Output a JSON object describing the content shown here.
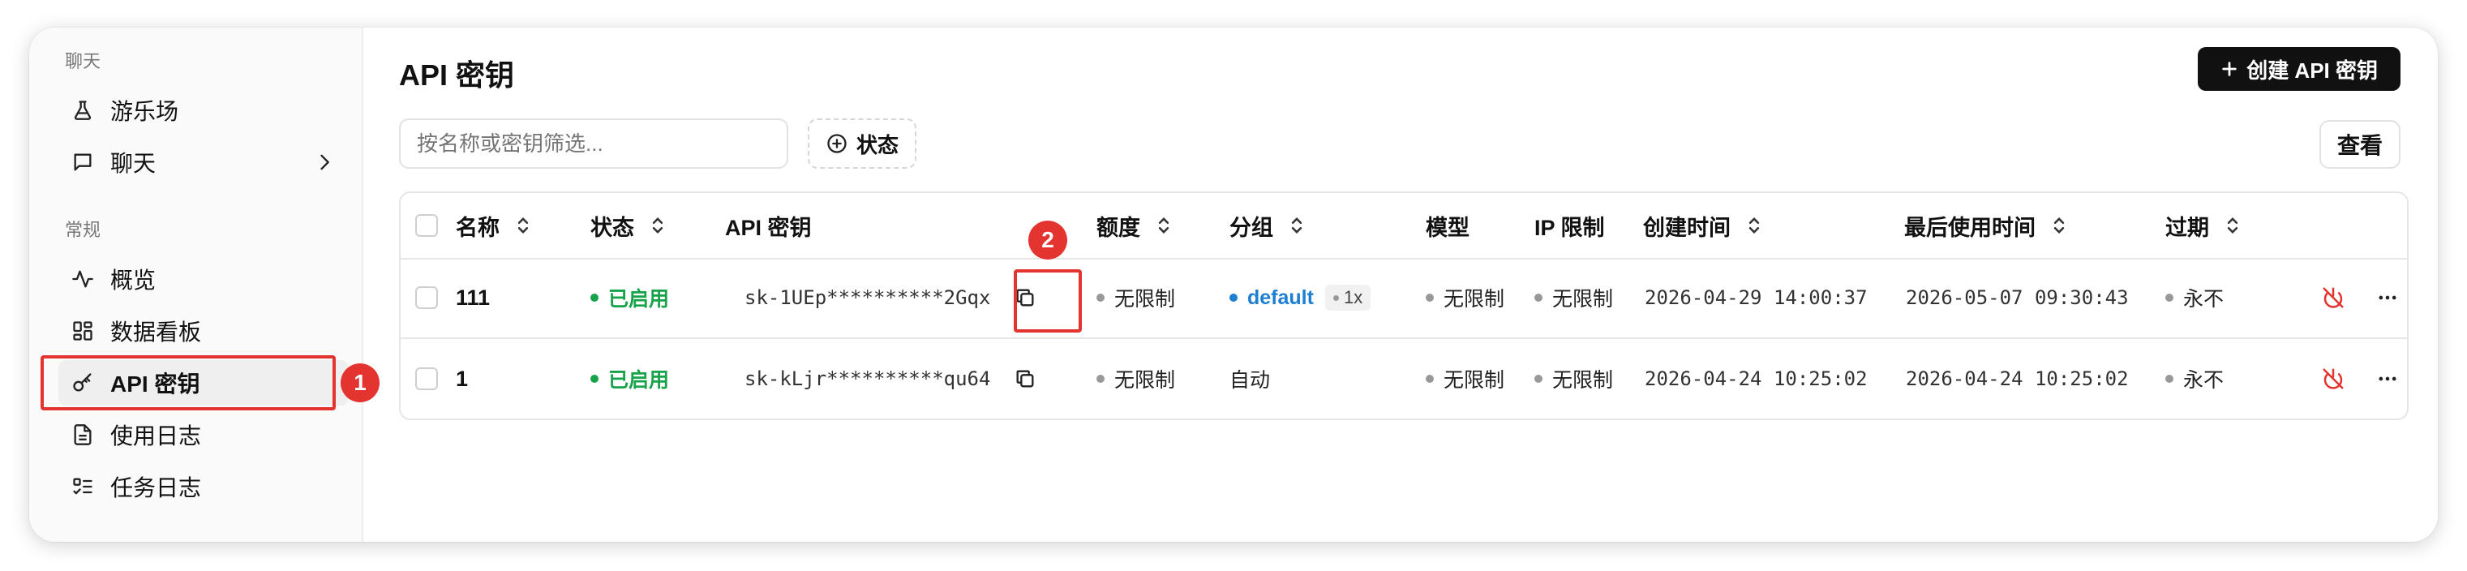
{
  "sidebar": {
    "chat_section_label": "聊天",
    "general_section_label": "常规",
    "items": [
      {
        "label": "游乐场"
      },
      {
        "label": "聊天"
      },
      {
        "label": "概览"
      },
      {
        "label": "数据看板"
      },
      {
        "label": "API 密钥"
      },
      {
        "label": "使用日志"
      },
      {
        "label": "任务日志"
      }
    ]
  },
  "annotations": {
    "badge1": "1",
    "badge2": "2"
  },
  "header": {
    "title": "API 密钥",
    "create_button": "创建 API 密钥"
  },
  "toolbar": {
    "search_placeholder": "按名称或密钥筛选...",
    "status_filter": "状态",
    "view_button": "查看"
  },
  "table": {
    "columns": [
      "名称",
      "状态",
      "API 密钥",
      "额度",
      "分组",
      "模型",
      "IP 限制",
      "创建时间",
      "最后使用时间",
      "过期"
    ],
    "rows": [
      {
        "name": "111",
        "status": "已启用",
        "key": "sk-1UEp**********2Gqx",
        "quota": "无限制",
        "group": "default",
        "group_ratio": "1x",
        "models": "无限制",
        "ip_limit": "无限制",
        "created": "2026-04-29 14:00:37",
        "last_used": "2026-05-07 09:30:43",
        "expires": "永不"
      },
      {
        "name": "1",
        "status": "已启用",
        "key": "sk-kLjr**********qu64",
        "quota": "无限制",
        "group": "自动",
        "models": "无限制",
        "ip_limit": "无限制",
        "created": "2026-04-24 10:25:02",
        "last_used": "2026-04-24 10:25:02",
        "expires": "永不"
      }
    ]
  },
  "colors": {
    "accent_red": "#e3342f",
    "status_green": "#16a34a",
    "group_blue": "#1d7fd1",
    "button_dark": "#111111"
  }
}
